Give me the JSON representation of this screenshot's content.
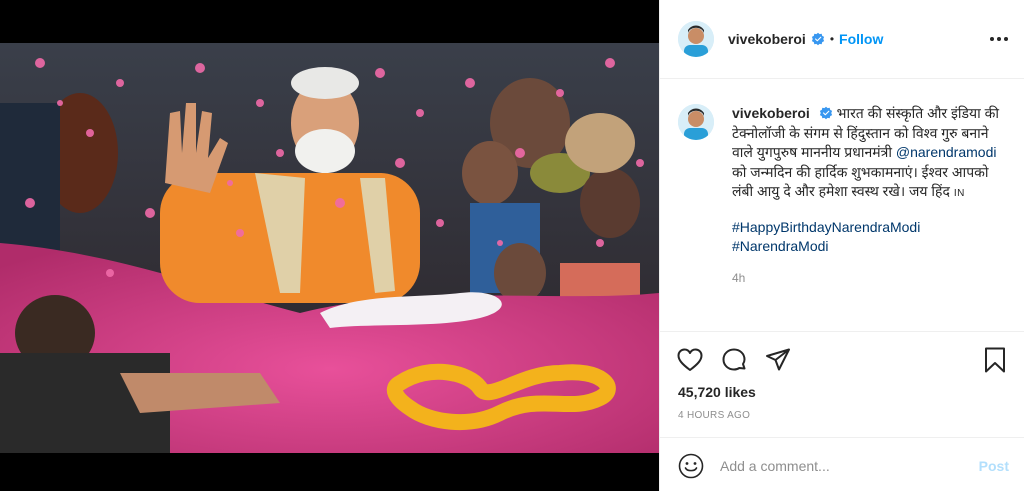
{
  "post": {
    "username": "vivekoberoi",
    "separator": "•",
    "follow_label": "Follow",
    "caption": {
      "username": "vivekoberoi",
      "text_before_mention": "भारत की संस्कृति और इंडिया की टेक्नोलॉजी के संगम से हिंदुस्तान को विश्व गुरु बनाने वाले युगपुरुष माननीय प्रधानमंत्री",
      "mention": "@narendramodi",
      "text_after_mention": "को जन्मदिन की हार्दिक शुभकामनाएं। ईश्वर आपको लंबी आयु दे और हमेशा स्वस्थ रखे। जय हिंद",
      "flag": "IN",
      "hashtags": [
        "#HappyBirthdayNarendraModi",
        "#NarendraModi"
      ],
      "time_ago": "4h"
    },
    "likes": "45,720 likes",
    "posted_time": "4 HOURS AGO"
  },
  "comment": {
    "placeholder": "Add a comment...",
    "post_label": "Post"
  },
  "icons": {
    "verified": "verified-badge-icon",
    "more": "more-options-icon",
    "like": "heart-icon",
    "comment": "comment-icon",
    "share": "share-icon",
    "save": "bookmark-icon",
    "emoji": "emoji-icon"
  },
  "colors": {
    "accent": "#0095f6",
    "link": "#00376b",
    "muted": "#8e8e8e",
    "post_disabled": "#b2dffc"
  }
}
